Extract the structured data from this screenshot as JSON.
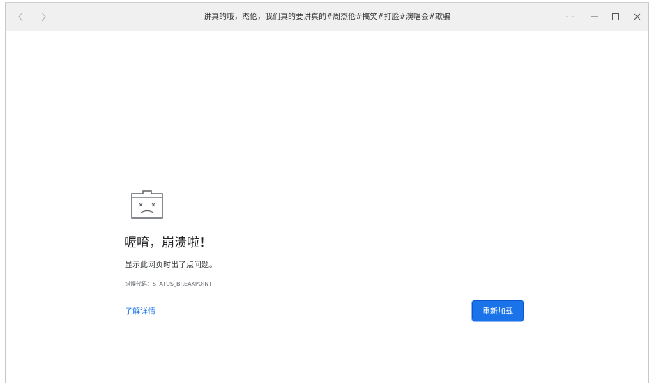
{
  "window": {
    "title": "讲真的哦，杰伦，我们真的要讲真的#周杰伦#搞笑#打脸#演唱会#欺骗"
  },
  "toolbar": {
    "back_icon": "chevron-left-icon",
    "forward_icon": "chevron-right-icon",
    "more_label": "···",
    "minimize_icon": "minimize-icon",
    "maximize_icon": "maximize-icon",
    "close_icon": "close-icon"
  },
  "error_page": {
    "icon": "sad-tab-icon",
    "heading": "喔唷，崩溃啦！",
    "description": "显示此网页时出了点问题。",
    "error_code": "错误代码：STATUS_BREAKPOINT",
    "learn_more": "了解详情",
    "reload_button": "重新加载"
  },
  "colors": {
    "titlebar": "#f0f0f0",
    "accent": "#1a73e8",
    "text": "#202124"
  }
}
